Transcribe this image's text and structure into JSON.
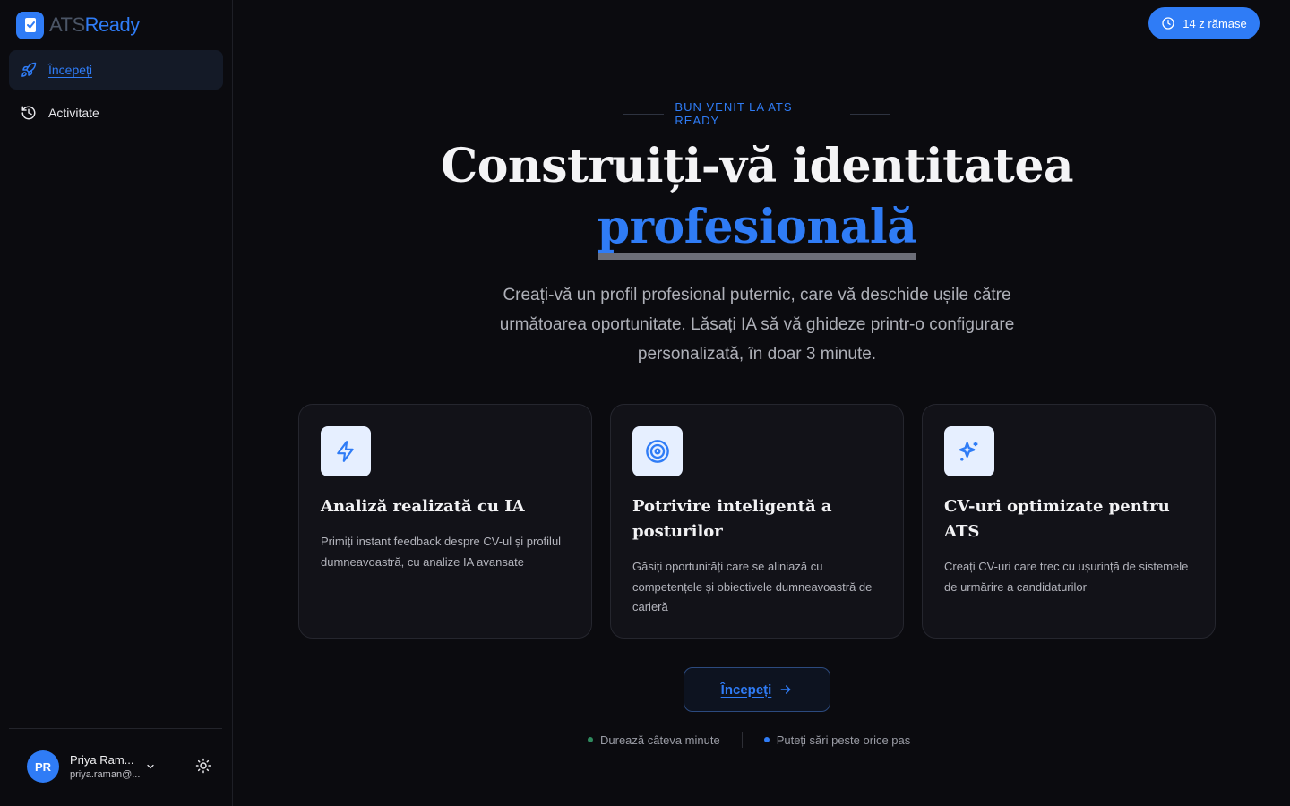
{
  "brand": {
    "ats": "ATS",
    "ready": "Ready"
  },
  "sidebar": {
    "items": [
      {
        "label": "Începeți",
        "icon": "rocket-icon",
        "active": true
      },
      {
        "label": "Activitate",
        "icon": "history-icon",
        "active": false
      }
    ],
    "user": {
      "initials": "PR",
      "name": "Priya Ram...",
      "email": "priya.raman@..."
    }
  },
  "header": {
    "trial_label": "14 z rămase"
  },
  "hero": {
    "eyebrow": "BUN VENIT LA ATS READY",
    "title_line1": "Construiți-vă identitatea",
    "title_accent": "profesională",
    "subtitle": "Creați-vă un profil profesional puternic, care vă deschide ușile către următoarea oportunitate. Lăsați IA să vă ghideze printr-o configurare personalizată, în doar 3 minute."
  },
  "cards": [
    {
      "icon": "lightning-icon",
      "title": "Analiză realizată cu IA",
      "desc": "Primiți instant feedback despre CV-ul și profilul dumneavoastră, cu analize IA avansate"
    },
    {
      "icon": "target-icon",
      "title": "Potrivire inteligentă a posturilor",
      "desc": "Găsiți oportunități care se aliniază cu competențele și obiectivele dumneavoastră de carieră"
    },
    {
      "icon": "sparkles-icon",
      "title": "CV-uri optimizate pentru ATS",
      "desc": "Creați CV-uri care trec cu ușurință de sistemele de urmărire a candidaturilor"
    }
  ],
  "cta": {
    "label": "Începeți"
  },
  "notes": [
    {
      "text": "Durează câteva minute",
      "color": "#2f8a5e"
    },
    {
      "text": "Puteți sări peste orice pas",
      "color": "#2f7cf6"
    }
  ],
  "colors": {
    "accent": "#2f7cf6",
    "background": "#0b0b0f",
    "card": "#121218"
  }
}
